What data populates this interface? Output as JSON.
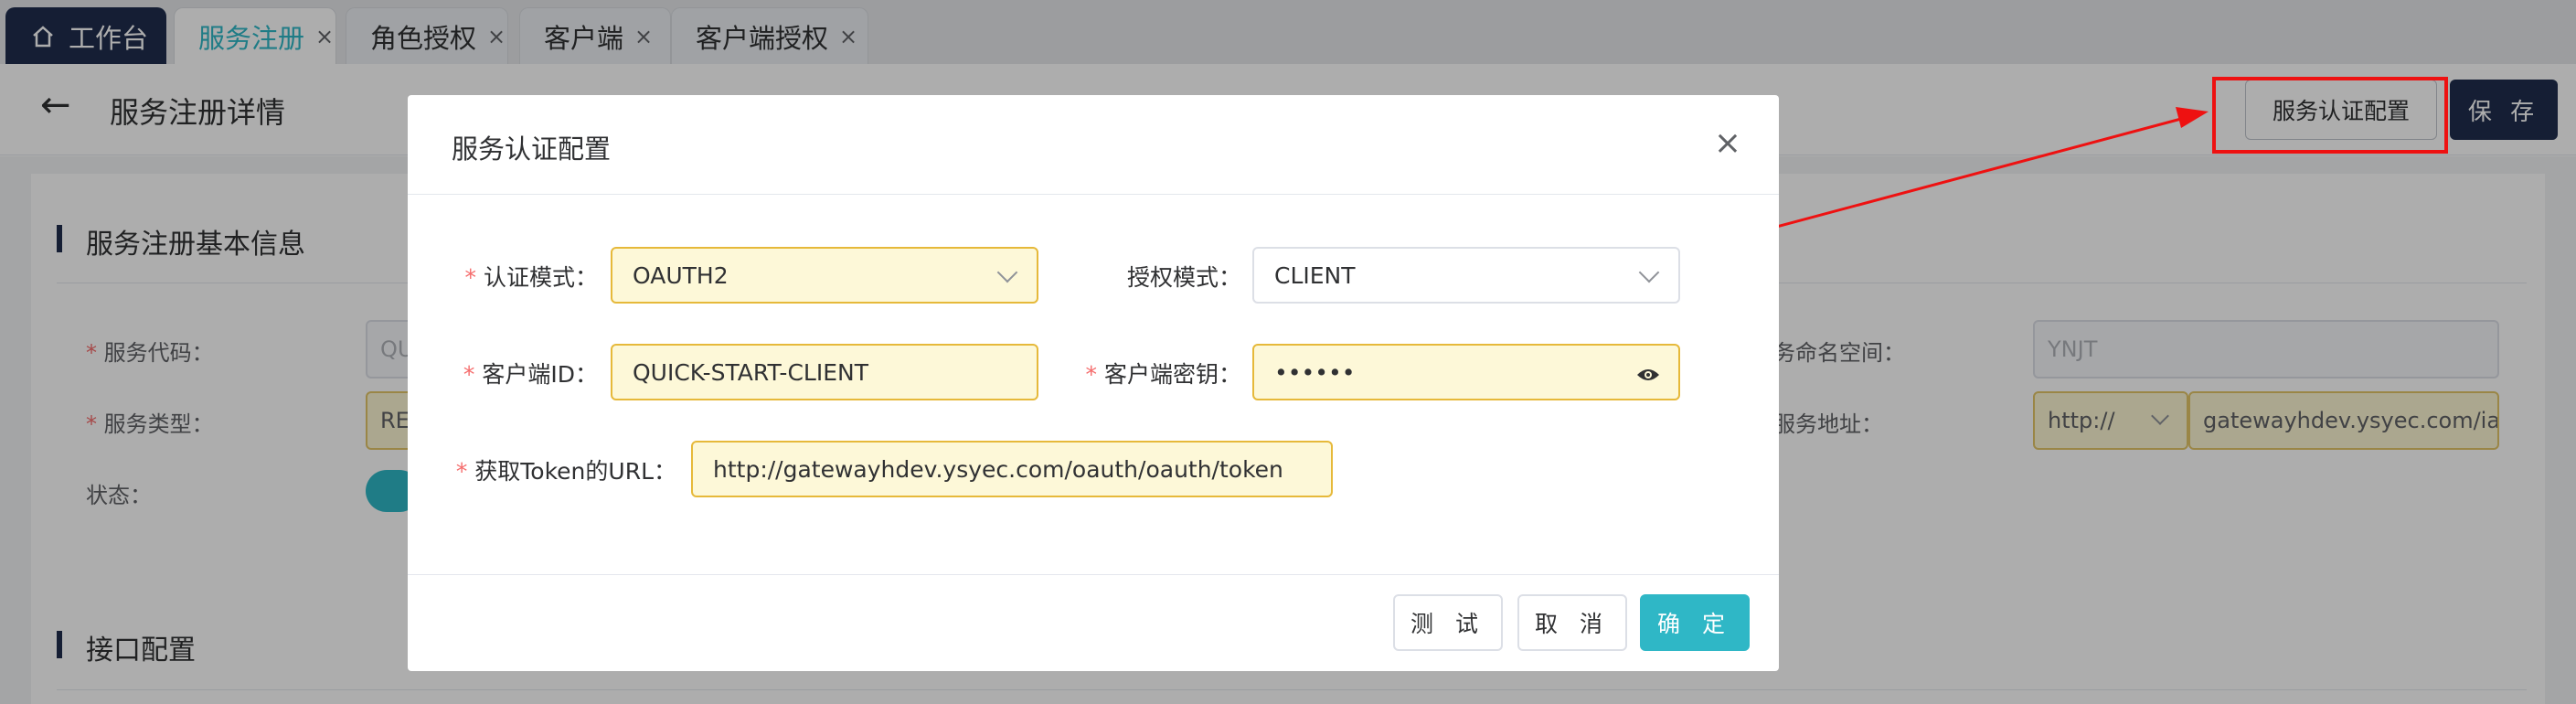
{
  "tabs": [
    {
      "label": "工作台",
      "icon": "home-icon"
    },
    {
      "label": "服务注册",
      "close": "×"
    },
    {
      "label": "角色授权",
      "close": "×"
    },
    {
      "label": "客户端",
      "close": "×"
    },
    {
      "label": "客户端授权",
      "close": "×"
    }
  ],
  "header": {
    "back_icon": "←",
    "title": "服务注册详情",
    "auth_config_button": "服务认证配置",
    "save_button": "保 存"
  },
  "background": {
    "section_basic": "服务注册基本信息",
    "label_code": "服务代码：",
    "code_value": "QU",
    "label_type": "服务类型：",
    "type_value": "RE",
    "label_status": "状态：",
    "label_namespace": "务命名空间：",
    "namespace_value": "YNJT",
    "label_address": "服务地址：",
    "protocol_value": "http://",
    "address_value": "gatewayhdev.ysyec.com/ia",
    "section_api": "接口配置"
  },
  "dialog": {
    "title": "服务认证配置",
    "close_icon": "×",
    "auth_mode_label": "认证模式：",
    "auth_mode_value": "OAUTH2",
    "grant_mode_label": "授权模式：",
    "grant_mode_value": "CLIENT",
    "client_id_label": "客户端ID：",
    "client_id_value": "QUICK-START-CLIENT",
    "client_secret_label": "客户端密钥：",
    "client_secret_value": "••••••",
    "token_url_label": "获取Token的URL：",
    "token_url_value": "http://gatewayhdev.ysyec.com/oauth/oauth/token",
    "required_mark": "*",
    "buttons": {
      "test": "测 试",
      "cancel": "取 消",
      "confirm": "确 定"
    }
  },
  "annotation": {
    "color": "#ee1111"
  }
}
